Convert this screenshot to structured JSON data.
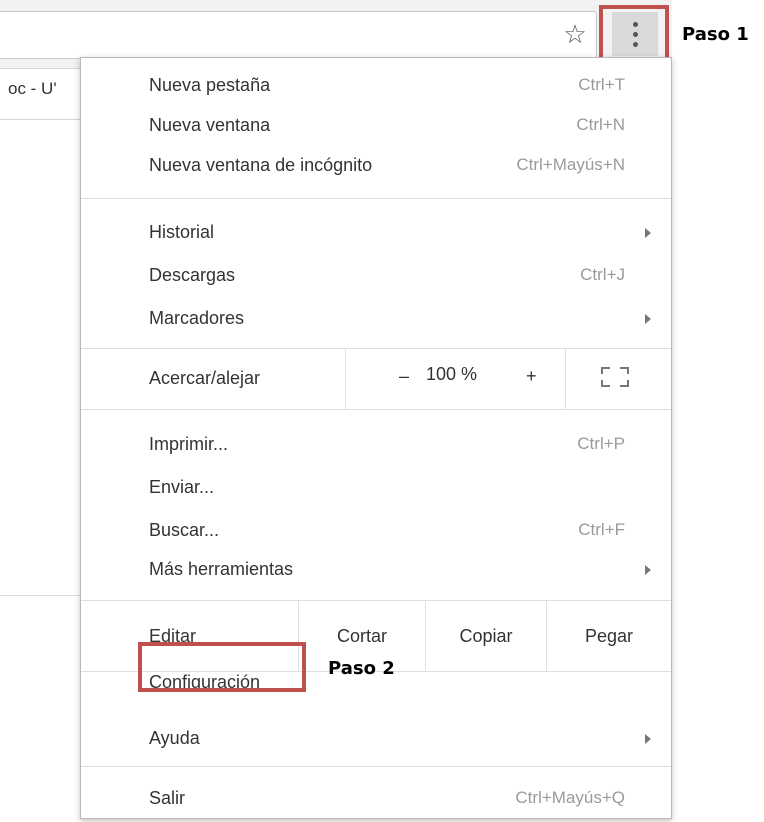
{
  "browser": {
    "tab_fragment": "oc - U'",
    "star_icon": "star-icon",
    "menu_icon": "kebab-menu-icon"
  },
  "callouts": {
    "step1": "Paso 1",
    "step2": "Paso 2",
    "highlight_color": "#c0504d"
  },
  "menu": {
    "new_tab": {
      "label": "Nueva pestaña",
      "shortcut": "Ctrl+T"
    },
    "new_window": {
      "label": "Nueva ventana",
      "shortcut": "Ctrl+N"
    },
    "incognito": {
      "label": "Nueva ventana de incógnito",
      "shortcut": "Ctrl+Mayús+N"
    },
    "history": {
      "label": "Historial"
    },
    "downloads": {
      "label": "Descargas",
      "shortcut": "Ctrl+J"
    },
    "bookmarks": {
      "label": "Marcadores"
    },
    "zoom": {
      "label": "Acercar/alejar",
      "minus": "–",
      "value": "100 %",
      "plus": "+"
    },
    "print": {
      "label": "Imprimir...",
      "shortcut": "Ctrl+P"
    },
    "cast": {
      "label": "Enviar..."
    },
    "find": {
      "label": "Buscar...",
      "shortcut": "Ctrl+F"
    },
    "more_tools": {
      "label": "Más herramientas"
    },
    "edit": {
      "label": "Editar",
      "cut": "Cortar",
      "copy": "Copiar",
      "paste": "Pegar"
    },
    "settings": {
      "label": "Configuración"
    },
    "help": {
      "label": "Ayuda"
    },
    "exit": {
      "label": "Salir",
      "shortcut": "Ctrl+Mayús+Q"
    }
  }
}
